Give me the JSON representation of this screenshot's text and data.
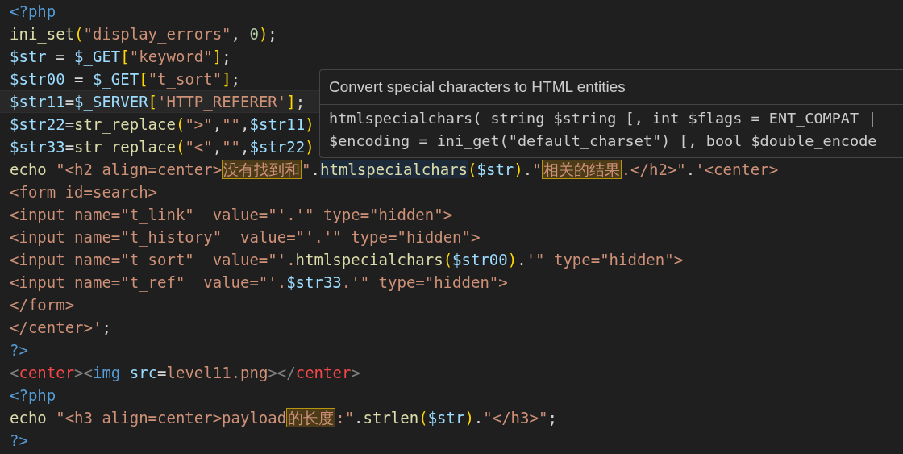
{
  "editor": {
    "lines": [
      {
        "current": false,
        "tokens": [
          {
            "kind": "php-tag",
            "text": "<?php"
          }
        ]
      },
      {
        "current": false,
        "tokens": [
          {
            "kind": "function",
            "text": "ini_set"
          },
          {
            "kind": "bracket",
            "text": "("
          },
          {
            "kind": "string",
            "text": "\"display_errors\""
          },
          {
            "kind": "plain",
            "text": ", "
          },
          {
            "kind": "number",
            "text": "0"
          },
          {
            "kind": "bracket",
            "text": ")"
          },
          {
            "kind": "plain",
            "text": ";"
          }
        ]
      },
      {
        "current": false,
        "tokens": [
          {
            "kind": "variable",
            "text": "$str"
          },
          {
            "kind": "plain",
            "text": " = "
          },
          {
            "kind": "variable",
            "text": "$_GET"
          },
          {
            "kind": "bracket",
            "text": "["
          },
          {
            "kind": "string",
            "text": "\"keyword\""
          },
          {
            "kind": "bracket",
            "text": "]"
          },
          {
            "kind": "plain",
            "text": ";"
          }
        ]
      },
      {
        "current": false,
        "tokens": [
          {
            "kind": "variable",
            "text": "$str00"
          },
          {
            "kind": "plain",
            "text": " = "
          },
          {
            "kind": "variable",
            "text": "$_GET"
          },
          {
            "kind": "bracket",
            "text": "["
          },
          {
            "kind": "string",
            "text": "\"t_sort\""
          },
          {
            "kind": "bracket",
            "text": "]"
          },
          {
            "kind": "plain",
            "text": ";"
          }
        ]
      },
      {
        "current": true,
        "tokens": [
          {
            "kind": "variable",
            "text": "$str11"
          },
          {
            "kind": "plain",
            "text": "="
          },
          {
            "kind": "variable",
            "text": "$_SERVER"
          },
          {
            "kind": "bracket",
            "text": "["
          },
          {
            "kind": "string",
            "text": "'HTTP_REFERER'"
          },
          {
            "kind": "bracket",
            "text": "]"
          },
          {
            "kind": "plain",
            "text": ";"
          }
        ]
      },
      {
        "current": false,
        "tokens": [
          {
            "kind": "variable",
            "text": "$str22"
          },
          {
            "kind": "plain",
            "text": "="
          },
          {
            "kind": "function",
            "text": "str_replace"
          },
          {
            "kind": "bracket",
            "text": "("
          },
          {
            "kind": "string",
            "text": "\">\""
          },
          {
            "kind": "plain",
            "text": ","
          },
          {
            "kind": "string",
            "text": "\"\""
          },
          {
            "kind": "plain",
            "text": ","
          },
          {
            "kind": "variable",
            "text": "$str11"
          },
          {
            "kind": "bracket",
            "text": ")"
          }
        ]
      },
      {
        "current": false,
        "tokens": [
          {
            "kind": "variable",
            "text": "$str33"
          },
          {
            "kind": "plain",
            "text": "="
          },
          {
            "kind": "function",
            "text": "str_replace"
          },
          {
            "kind": "bracket",
            "text": "("
          },
          {
            "kind": "string",
            "text": "\"<\""
          },
          {
            "kind": "plain",
            "text": ","
          },
          {
            "kind": "string",
            "text": "\"\""
          },
          {
            "kind": "plain",
            "text": ","
          },
          {
            "kind": "variable",
            "text": "$str22"
          },
          {
            "kind": "bracket",
            "text": ")"
          }
        ]
      },
      {
        "current": false,
        "tokens": [
          {
            "kind": "keyword",
            "text": "echo"
          },
          {
            "kind": "string",
            "text": " \"<h2 align=center>"
          },
          {
            "kind": "match",
            "text": "没有找到和"
          },
          {
            "kind": "string",
            "text": "\""
          },
          {
            "kind": "plain",
            "text": "."
          },
          {
            "kind": "hover",
            "text": "htmlspecialchars"
          },
          {
            "kind": "bracket",
            "text": "("
          },
          {
            "kind": "variable",
            "text": "$str"
          },
          {
            "kind": "bracket",
            "text": ")"
          },
          {
            "kind": "plain",
            "text": "."
          },
          {
            "kind": "string",
            "text": "\""
          },
          {
            "kind": "match",
            "text": "相关的结果"
          },
          {
            "kind": "string",
            "text": ".</h2>\""
          },
          {
            "kind": "plain",
            "text": "."
          },
          {
            "kind": "string",
            "text": "'<center>"
          }
        ]
      },
      {
        "current": false,
        "tokens": [
          {
            "kind": "string",
            "text": "<form id=search>"
          }
        ]
      },
      {
        "current": false,
        "tokens": [
          {
            "kind": "string",
            "text": "<input name=\"t_link\"  value=\"'.'\" type=\"hidden\">"
          }
        ]
      },
      {
        "current": false,
        "tokens": [
          {
            "kind": "string",
            "text": "<input name=\"t_history\"  value=\"'.'\" type=\"hidden\">"
          }
        ]
      },
      {
        "current": false,
        "tokens": [
          {
            "kind": "string",
            "text": "<input name=\"t_sort\"  value=\"'."
          },
          {
            "kind": "function",
            "text": "htmlspecialchars"
          },
          {
            "kind": "bracket",
            "text": "("
          },
          {
            "kind": "variable",
            "text": "$str00"
          },
          {
            "kind": "bracket",
            "text": ")"
          },
          {
            "kind": "plain",
            "text": "."
          },
          {
            "kind": "string",
            "text": "'\" type=\"hidden\">"
          }
        ]
      },
      {
        "current": false,
        "tokens": [
          {
            "kind": "string",
            "text": "<input name=\"t_ref\"  value=\"'."
          },
          {
            "kind": "variable",
            "text": "$str33"
          },
          {
            "kind": "string",
            "text": ".'\" type=\"hidden\">"
          }
        ]
      },
      {
        "current": false,
        "tokens": [
          {
            "kind": "string",
            "text": "</form>"
          }
        ]
      },
      {
        "current": false,
        "tokens": [
          {
            "kind": "string",
            "text": "</center>'"
          },
          {
            "kind": "plain",
            "text": ";"
          }
        ]
      },
      {
        "current": false,
        "tokens": [
          {
            "kind": "php-tag",
            "text": "?>"
          }
        ]
      },
      {
        "current": false,
        "tokens": [
          {
            "kind": "tag-angle",
            "text": "<"
          },
          {
            "kind": "tag",
            "text": "center"
          },
          {
            "kind": "tag-angle",
            "text": "><"
          },
          {
            "kind": "element",
            "text": "img"
          },
          {
            "kind": "attribute",
            "text": " src"
          },
          {
            "kind": "plain",
            "text": "="
          },
          {
            "kind": "string",
            "text": "level11.png"
          },
          {
            "kind": "tag-angle",
            "text": "></"
          },
          {
            "kind": "tag",
            "text": "center"
          },
          {
            "kind": "tag-angle",
            "text": ">"
          }
        ]
      },
      {
        "current": false,
        "tokens": [
          {
            "kind": "php-tag",
            "text": "<?php"
          }
        ]
      },
      {
        "current": false,
        "tokens": [
          {
            "kind": "keyword",
            "text": "echo"
          },
          {
            "kind": "string",
            "text": " \"<h3 align=center>payload"
          },
          {
            "kind": "match",
            "text": "的长度"
          },
          {
            "kind": "string",
            "text": ":\""
          },
          {
            "kind": "plain",
            "text": "."
          },
          {
            "kind": "function",
            "text": "strlen"
          },
          {
            "kind": "bracket",
            "text": "("
          },
          {
            "kind": "variable",
            "text": "$str"
          },
          {
            "kind": "bracket",
            "text": ")"
          },
          {
            "kind": "plain",
            "text": "."
          },
          {
            "kind": "string",
            "text": "\"</h3>\""
          },
          {
            "kind": "plain",
            "text": ";"
          }
        ]
      },
      {
        "current": false,
        "tokens": [
          {
            "kind": "php-tag",
            "text": "?>"
          }
        ]
      }
    ]
  },
  "hover_tooltip": {
    "description": "Convert special characters to HTML entities",
    "signature": [
      "htmlspecialchars( string $string [, int $flags = ENT_COMPAT |",
      "$encoding = ini_get(\"default_charset\") [, bool $double_encode"
    ]
  }
}
